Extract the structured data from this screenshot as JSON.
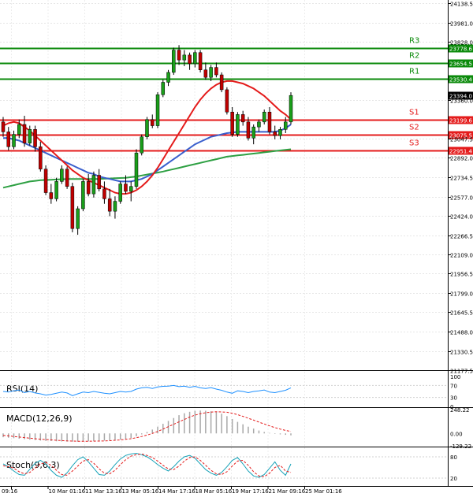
{
  "chart_data": {
    "type": "candlestick",
    "main_axis": {
      "ylim": [
        21177.5,
        24138.5
      ],
      "ticks": [
        24138.5,
        23981.0,
        23828.0,
        23360.0,
        23047.5,
        22892.0,
        22734.5,
        22577.0,
        22424.0,
        22266.5,
        22109.0,
        21956.5,
        21799.0,
        21645.5,
        21488.0,
        21330.5,
        21177.5
      ]
    },
    "x_labels": [
      "09:16",
      "10 Mar 01:16",
      "11 Mar 13:16",
      "13 Mar 05:16",
      "14 Mar 17:16",
      "18 Mar 05:16",
      "19 Mar 17:16",
      "21 Mar 09:16",
      "25 Mar 01:16"
    ],
    "current_price": 23394.0,
    "levels": [
      {
        "name": "R3",
        "value": 23778.6,
        "label": "23778.6",
        "color": "#0a8a0a"
      },
      {
        "name": "R2",
        "value": 23654.5,
        "label": "23654.5",
        "color": "#0a8a0a"
      },
      {
        "name": "R1",
        "value": 23530.4,
        "label": "23530.4",
        "color": "#0a8a0a"
      },
      {
        "name": "S1",
        "value": 23199.6,
        "label": "23199.6",
        "color": "#e41b1b"
      },
      {
        "name": "S2",
        "value": 23075.5,
        "label": "23075.5",
        "color": "#e41b1b"
      },
      {
        "name": "S3",
        "value": 22951.4,
        "label": "22951.4",
        "color": "#e41b1b"
      }
    ],
    "candles": [
      [
        23180,
        23220,
        23060,
        23100
      ],
      [
        23100,
        23140,
        22950,
        22980
      ],
      [
        22980,
        23110,
        22960,
        23080
      ],
      [
        23080,
        23200,
        23050,
        23160
      ],
      [
        23160,
        23230,
        22980,
        23010
      ],
      [
        23010,
        23150,
        22990,
        23120
      ],
      [
        23120,
        23150,
        22940,
        22980
      ],
      [
        22980,
        23020,
        22780,
        22800
      ],
      [
        22800,
        22830,
        22590,
        22610
      ],
      [
        22610,
        22680,
        22520,
        22560
      ],
      [
        22560,
        22730,
        22540,
        22700
      ],
      [
        22700,
        22830,
        22680,
        22800
      ],
      [
        22800,
        22820,
        22640,
        22660
      ],
      [
        22660,
        22690,
        22290,
        22320
      ],
      [
        22320,
        22500,
        22270,
        22480
      ],
      [
        22480,
        22720,
        22460,
        22700
      ],
      [
        22700,
        22760,
        22580,
        22600
      ],
      [
        22600,
        22780,
        22570,
        22750
      ],
      [
        22750,
        22800,
        22620,
        22640
      ],
      [
        22640,
        22700,
        22520,
        22560
      ],
      [
        22560,
        22640,
        22420,
        22460
      ],
      [
        22460,
        22580,
        22400,
        22540
      ],
      [
        22540,
        22700,
        22520,
        22680
      ],
      [
        22680,
        22750,
        22600,
        22620
      ],
      [
        22620,
        22700,
        22540,
        22660
      ],
      [
        22660,
        22960,
        22640,
        22930
      ],
      [
        22930,
        23080,
        22910,
        23060
      ],
      [
        23060,
        23220,
        23040,
        23200
      ],
      [
        23200,
        23240,
        23130,
        23150
      ],
      [
        23150,
        23420,
        23130,
        23400
      ],
      [
        23400,
        23520,
        23380,
        23500
      ],
      [
        23500,
        23600,
        23470,
        23580
      ],
      [
        23580,
        23780,
        23560,
        23760
      ],
      [
        23760,
        23800,
        23640,
        23680
      ],
      [
        23680,
        23760,
        23630,
        23720
      ],
      [
        23720,
        23740,
        23600,
        23650
      ],
      [
        23650,
        23760,
        23620,
        23740
      ],
      [
        23740,
        23760,
        23580,
        23600
      ],
      [
        23600,
        23660,
        23520,
        23540
      ],
      [
        23540,
        23640,
        23510,
        23620
      ],
      [
        23620,
        23660,
        23540,
        23560
      ],
      [
        23560,
        23580,
        23420,
        23440
      ],
      [
        23440,
        23460,
        23240,
        23260
      ],
      [
        23260,
        23300,
        23060,
        23080
      ],
      [
        23080,
        23260,
        23060,
        23240
      ],
      [
        23240,
        23270,
        23150,
        23180
      ],
      [
        23180,
        23220,
        23030,
        23050
      ],
      [
        23050,
        23160,
        23000,
        23140
      ],
      [
        23140,
        23200,
        23100,
        23180
      ],
      [
        23180,
        23280,
        23160,
        23260
      ],
      [
        23260,
        23300,
        23080,
        23100
      ],
      [
        23100,
        23150,
        23040,
        23070
      ],
      [
        23070,
        23140,
        23040,
        23120
      ],
      [
        23120,
        23220,
        23090,
        23180
      ],
      [
        23180,
        23420,
        23160,
        23394
      ]
    ],
    "ma_red": [
      23150,
      23170,
      23180,
      23170,
      23140,
      23110,
      23070,
      23030,
      22990,
      22950,
      22910,
      22870,
      22830,
      22790,
      22760,
      22730,
      22710,
      22690,
      22670,
      22650,
      22630,
      22610,
      22600,
      22600,
      22610,
      22630,
      22660,
      22700,
      22750,
      22810,
      22880,
      22950,
      23020,
      23090,
      23160,
      23230,
      23300,
      23360,
      23410,
      23450,
      23480,
      23500,
      23510,
      23510,
      23500,
      23490,
      23470,
      23450,
      23420,
      23390,
      23350,
      23310,
      23270,
      23240,
      23200
    ],
    "ma_blue": [
      23050,
      23050,
      23040,
      23030,
      23010,
      22990,
      22970,
      22950,
      22930,
      22910,
      22890,
      22870,
      22850,
      22830,
      22810,
      22790,
      22770,
      22760,
      22740,
      22730,
      22720,
      22710,
      22700,
      22700,
      22700,
      22710,
      22720,
      22740,
      22760,
      22790,
      22820,
      22850,
      22880,
      22910,
      22940,
      22970,
      23000,
      23020,
      23040,
      23060,
      23070,
      23080,
      23090,
      23095,
      23100,
      23100,
      23100,
      23100,
      23100,
      23100,
      23100,
      23100,
      23110,
      23130,
      23160
    ],
    "ma_green": [
      22650,
      22660,
      22670,
      22680,
      22690,
      22700,
      22705,
      22710,
      22712,
      22714,
      22716,
      22718,
      22720,
      22720,
      22720,
      22720,
      22720,
      22720,
      22720,
      22722,
      22724,
      22726,
      22728,
      22730,
      22735,
      22740,
      22748,
      22756,
      22764,
      22772,
      22780,
      22790,
      22800,
      22810,
      22820,
      22830,
      22840,
      22850,
      22860,
      22870,
      22880,
      22890,
      22900,
      22905,
      22910,
      22915,
      22920,
      22925,
      22930,
      22935,
      22940,
      22945,
      22950,
      22955,
      22960
    ],
    "rsi": {
      "label": "RSI(14)",
      "ticks": [
        100,
        70,
        30,
        0
      ],
      "values": [
        50,
        48,
        52,
        55,
        46,
        50,
        45,
        42,
        38,
        40,
        44,
        48,
        45,
        36,
        42,
        48,
        46,
        50,
        47,
        44,
        42,
        46,
        50,
        48,
        50,
        58,
        62,
        64,
        60,
        65,
        67,
        68,
        70,
        66,
        68,
        64,
        67,
        62,
        60,
        63,
        58,
        54,
        48,
        44,
        52,
        50,
        46,
        50,
        52,
        55,
        48,
        46,
        50,
        54,
        62
      ]
    },
    "macd": {
      "label": "MACD(12,26,9)",
      "ticks": [
        248.22,
        0.0,
        -129.22
      ],
      "ylim": [
        -129.22,
        248.22
      ],
      "hist": [
        -40,
        -45,
        -50,
        -55,
        -60,
        -65,
        -70,
        -75,
        -78,
        -80,
        -82,
        -84,
        -85,
        -86,
        -86,
        -84,
        -82,
        -80,
        -78,
        -76,
        -72,
        -68,
        -64,
        -58,
        -50,
        -30,
        -10,
        15,
        40,
        70,
        100,
        130,
        160,
        190,
        210,
        225,
        235,
        238,
        236,
        230,
        220,
        205,
        180,
        150,
        120,
        95,
        70,
        50,
        30,
        15,
        5,
        -5,
        -10,
        -15,
        -20
      ],
      "signal": [
        -20,
        -26,
        -32,
        -38,
        -44,
        -50,
        -55,
        -60,
        -64,
        -68,
        -72,
        -75,
        -78,
        -80,
        -82,
        -82,
        -82,
        -81,
        -80,
        -78,
        -76,
        -72,
        -68,
        -62,
        -55,
        -45,
        -32,
        -18,
        0,
        20,
        45,
        70,
        95,
        120,
        145,
        170,
        190,
        205,
        215,
        222,
        225,
        224,
        220,
        210,
        195,
        178,
        158,
        138,
        118,
        98,
        78,
        60,
        45,
        32,
        20
      ]
    },
    "stoch": {
      "label": "Stoch(9,6,3)",
      "ticks": [
        80,
        20
      ],
      "k": [
        60,
        52,
        40,
        30,
        28,
        45,
        62,
        70,
        60,
        42,
        28,
        22,
        35,
        55,
        72,
        80,
        66,
        48,
        30,
        28,
        40,
        58,
        74,
        84,
        88,
        90,
        86,
        80,
        70,
        58,
        48,
        40,
        52,
        68,
        80,
        84,
        76,
        60,
        44,
        34,
        28,
        36,
        52,
        70,
        78,
        60,
        40,
        26,
        22,
        30,
        48,
        66,
        42,
        28,
        60
      ],
      "d": [
        55,
        52,
        48,
        38,
        32,
        36,
        48,
        60,
        64,
        56,
        42,
        30,
        28,
        40,
        54,
        68,
        72,
        62,
        46,
        34,
        32,
        42,
        58,
        72,
        82,
        86,
        88,
        84,
        78,
        68,
        56,
        46,
        44,
        54,
        68,
        78,
        80,
        70,
        56,
        42,
        32,
        30,
        38,
        54,
        68,
        70,
        56,
        38,
        26,
        24,
        34,
        50,
        56,
        40,
        36
      ]
    }
  }
}
